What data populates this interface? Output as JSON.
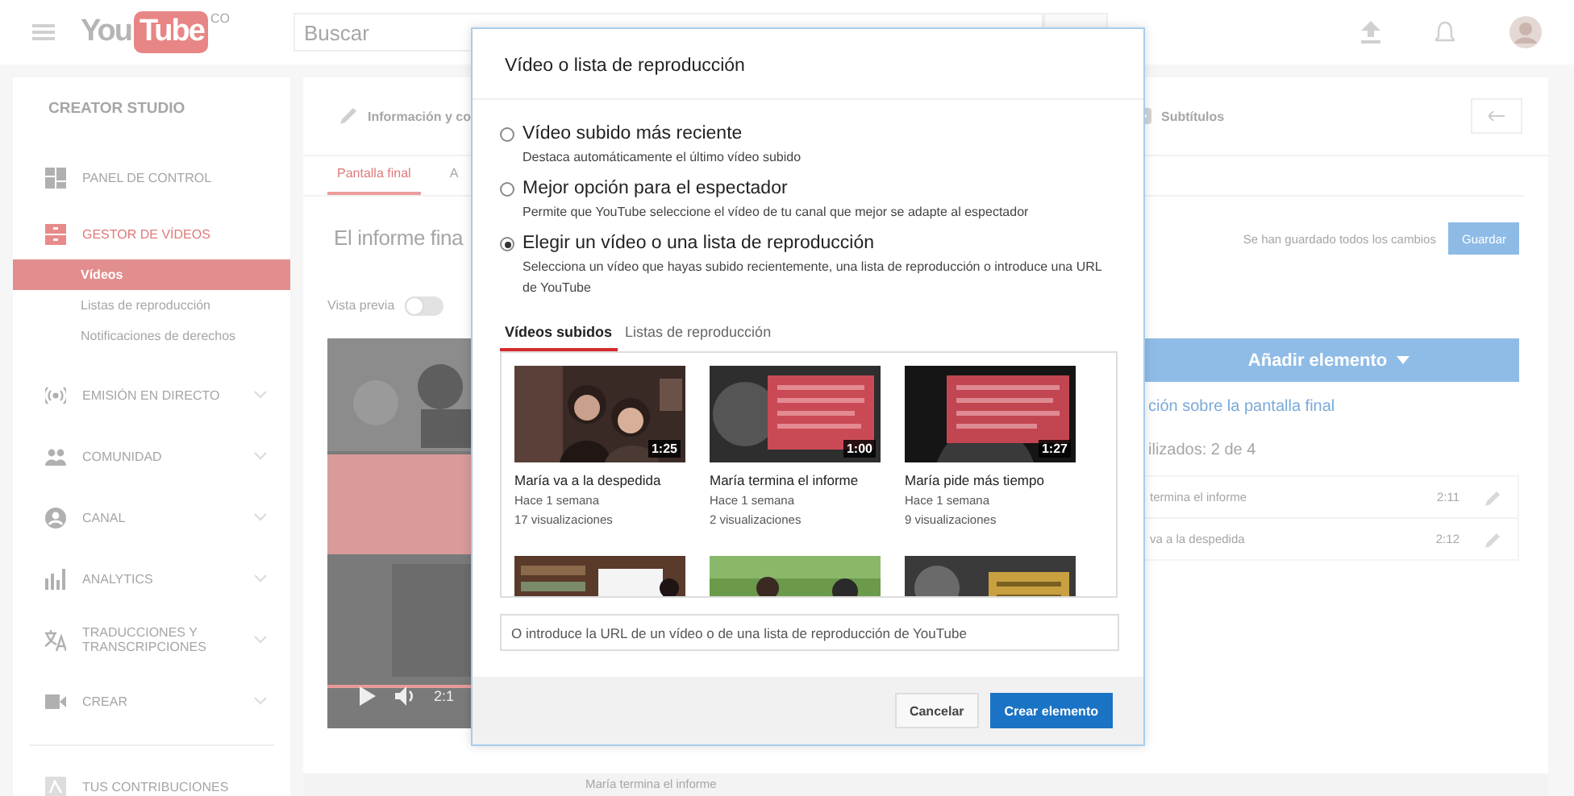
{
  "top_bar": {
    "logo": {
      "you": "You",
      "tube": "Tube",
      "country": "CO"
    },
    "search": {
      "placeholder": "Buscar"
    }
  },
  "sidebar": {
    "title": "CREATOR STUDIO",
    "items": [
      {
        "label": "PANEL DE CONTROL",
        "kind": "link",
        "selected": false
      },
      {
        "label": "GESTOR DE VÍDEOS",
        "kind": "group",
        "selected": true,
        "expanded": true,
        "children": [
          {
            "label": "Vídeos",
            "selected": true
          },
          {
            "label": "Listas de reproducción",
            "selected": false
          },
          {
            "label": "Notificaciones de derechos",
            "selected": false
          }
        ]
      },
      {
        "label": "EMISIÓN EN DIRECTO",
        "kind": "group",
        "selected": false,
        "expanded": false
      },
      {
        "label": "COMUNIDAD",
        "kind": "group",
        "selected": false,
        "expanded": false
      },
      {
        "label": "CANAL",
        "kind": "group",
        "selected": false,
        "expanded": false
      },
      {
        "label": "ANALYTICS",
        "kind": "group",
        "selected": false,
        "expanded": false
      },
      {
        "label": "TRADUCCIONES Y TRANSCRIPCIONES",
        "kind": "group",
        "selected": false,
        "expanded": false
      },
      {
        "label": "CREAR",
        "kind": "group",
        "selected": false,
        "expanded": false
      }
    ],
    "footer_item": "TUS CONTRIBUCIONES"
  },
  "editor": {
    "tabs": [
      {
        "label": "Información y co"
      },
      {
        "label": "Subtítulos"
      }
    ],
    "subtabs": [
      {
        "label": "Pantalla final",
        "selected": true
      },
      {
        "label": "A",
        "selected": false
      }
    ],
    "title": "El informe fina",
    "preview": {
      "label": "Vista previa",
      "on": false
    },
    "player": {
      "time": "2:1"
    },
    "save_status": "Se han guardado todos los cambios",
    "save_button": {
      "label": "Guardar",
      "disabled": true
    },
    "add_button": "Añadir elemento",
    "help_link": "ción sobre la pantalla final",
    "usage": "ilizados: 2 de 4",
    "elements": [
      {
        "title": "termina el informe",
        "time": "2:11"
      },
      {
        "title": "va a la despedida",
        "time": "2:12"
      }
    ],
    "bottom_item": "María termina el informe"
  },
  "dialog": {
    "title": "Vídeo o lista de reproducción",
    "options": [
      {
        "label": "Vídeo subido más reciente",
        "description": "Destaca automáticamente el último vídeo subido",
        "selected": false
      },
      {
        "label": "Mejor opción para el espectador",
        "description": "Permite que YouTube seleccione el vídeo de tu canal que mejor se adapte al espectador",
        "selected": false
      },
      {
        "label": "Elegir un vídeo o una lista de reproducción",
        "description": "Selecciona un vídeo que hayas subido recientemente, una lista de reproducción o introduce una URL de YouTube",
        "selected": true
      }
    ],
    "tabs": [
      {
        "label": "Vídeos subidos",
        "selected": true
      },
      {
        "label": "Listas de reproducción",
        "selected": false
      }
    ],
    "videos": [
      {
        "title": "María va a la despedida",
        "age": "Hace 1 semana",
        "views": "17 visualizaciones",
        "duration": "1:25"
      },
      {
        "title": "María termina el informe",
        "age": "Hace 1 semana",
        "views": "2 visualizaciones",
        "duration": "1:00"
      },
      {
        "title": "María pide más tiempo",
        "age": "Hace 1 semana",
        "views": "9 visualizaciones",
        "duration": "1:27"
      }
    ],
    "url_field": {
      "placeholder": "O introduce la URL de un vídeo o de una lista de reproducción de YouTube"
    },
    "buttons": [
      {
        "label": "Cancelar",
        "kind": "secondary"
      },
      {
        "label": "Crear elemento",
        "kind": "primary"
      }
    ]
  }
}
